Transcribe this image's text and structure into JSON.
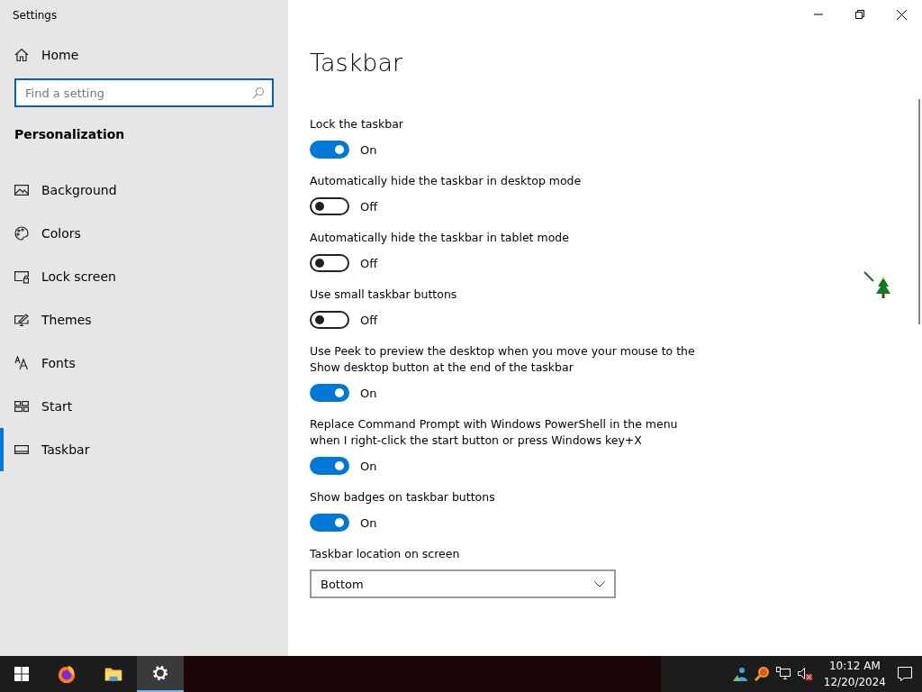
{
  "window": {
    "title": "Settings"
  },
  "sidebar": {
    "home": "Home",
    "search": {
      "placeholder": "Find a setting"
    },
    "section": "Personalization",
    "items": [
      {
        "kind": "background",
        "label": "Background",
        "selected": false
      },
      {
        "kind": "colors",
        "label": "Colors",
        "selected": false
      },
      {
        "kind": "lock",
        "label": "Lock screen",
        "selected": false
      },
      {
        "kind": "themes",
        "label": "Themes",
        "selected": false
      },
      {
        "kind": "fonts",
        "label": "Fonts",
        "selected": false
      },
      {
        "kind": "start",
        "label": "Start",
        "selected": false
      },
      {
        "kind": "taskbar",
        "label": "Taskbar",
        "selected": true
      }
    ]
  },
  "page": {
    "title": "Taskbar",
    "settings": [
      {
        "label": "Lock the taskbar",
        "on": true,
        "state_text": "On"
      },
      {
        "label": "Automatically hide the taskbar in desktop mode",
        "on": false,
        "state_text": "Off"
      },
      {
        "label": "Automatically hide the taskbar in tablet mode",
        "on": false,
        "state_text": "Off"
      },
      {
        "label": "Use small taskbar buttons",
        "on": false,
        "state_text": "Off"
      },
      {
        "label": "Use Peek to preview the desktop when you move your mouse to the Show desktop button at the end of the taskbar",
        "on": true,
        "state_text": "On"
      },
      {
        "label": "Replace Command Prompt with Windows PowerShell in the menu when I right-click the start button or press Windows key+X",
        "on": true,
        "state_text": "On"
      },
      {
        "label": "Show badges on taskbar buttons",
        "on": true,
        "state_text": "On"
      }
    ],
    "location": {
      "label": "Taskbar location on screen",
      "value": "Bottom"
    }
  },
  "taskbar": {
    "apps": [
      {
        "kind": "browser",
        "selected": false
      },
      {
        "kind": "folder",
        "selected": false
      },
      {
        "kind": "settings",
        "selected": true
      }
    ],
    "time": "10:12 AM",
    "date": "12/20/2024"
  }
}
